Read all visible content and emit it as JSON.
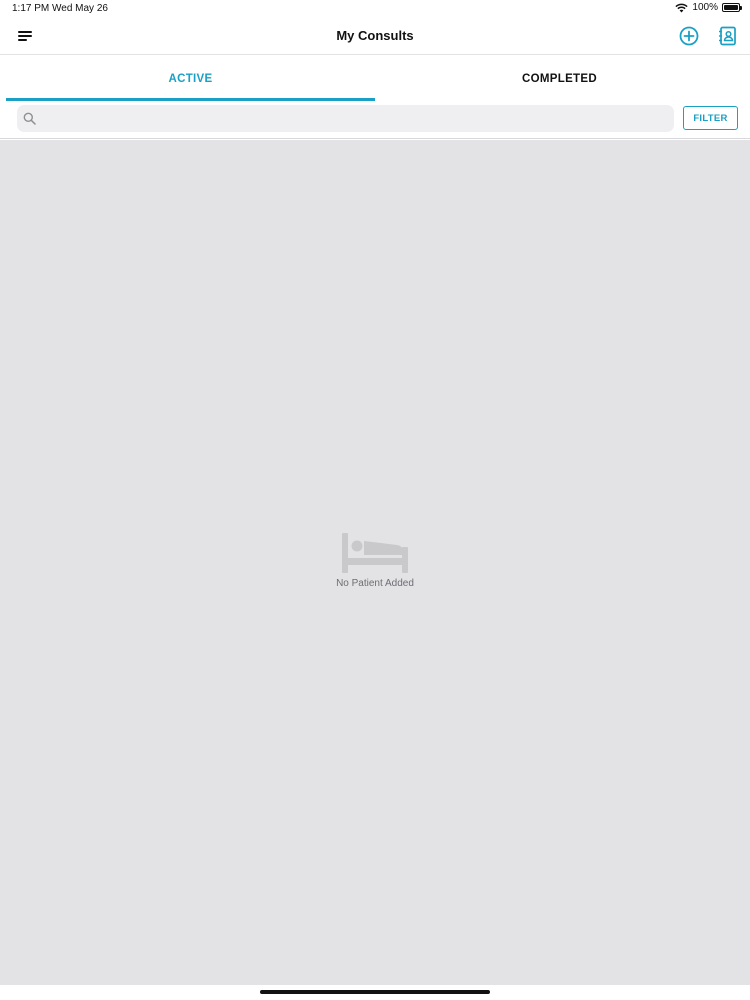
{
  "status_bar": {
    "time": "1:17 PM",
    "date": "Wed May 26",
    "battery_percent": "100%"
  },
  "nav": {
    "title": "My Consults",
    "menu_icon": "hamburger-menu-icon",
    "add_icon": "plus-circle-icon",
    "contacts_icon": "contacts-book-icon"
  },
  "tabs": [
    {
      "label": "ACTIVE",
      "selected": true
    },
    {
      "label": "COMPLETED",
      "selected": false
    }
  ],
  "search": {
    "placeholder": "",
    "value": ""
  },
  "filter": {
    "label": "FILTER"
  },
  "empty_state": {
    "icon": "bed-icon",
    "message": "No Patient Added"
  },
  "colors": {
    "accent": "#1aa0c4",
    "content_background": "#e3e2e5",
    "search_background": "#efeff1"
  }
}
